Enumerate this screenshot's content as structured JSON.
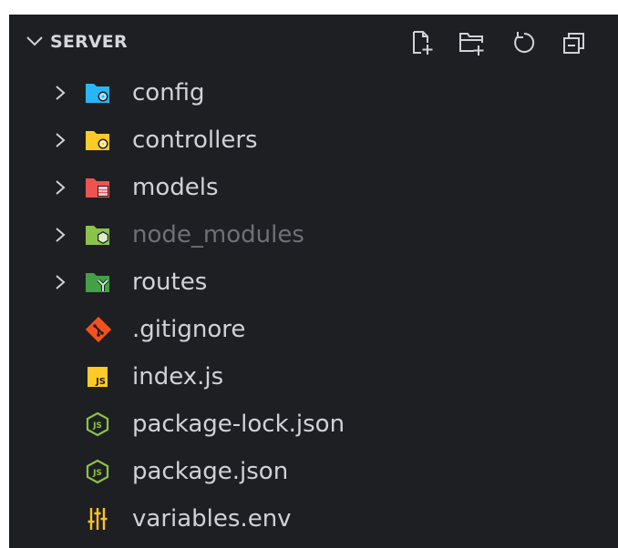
{
  "explorer": {
    "section_title": "SERVER",
    "toolbar": [
      {
        "icon": "new-file-icon"
      },
      {
        "icon": "new-folder-icon"
      },
      {
        "icon": "refresh-icon"
      },
      {
        "icon": "collapse-all-icon"
      }
    ],
    "items": [
      {
        "label": "config",
        "kind": "folder",
        "icon": "folder-config-icon",
        "color": "#29b6f6",
        "dimmed": false
      },
      {
        "label": "controllers",
        "kind": "folder",
        "icon": "folder-controllers-icon",
        "color": "#ffca28",
        "dimmed": false
      },
      {
        "label": "models",
        "kind": "folder",
        "icon": "folder-models-icon",
        "color": "#ef5350",
        "dimmed": false
      },
      {
        "label": "node_modules",
        "kind": "folder",
        "icon": "folder-node-icon",
        "color": "#8bc34a",
        "dimmed": true
      },
      {
        "label": "routes",
        "kind": "folder",
        "icon": "folder-routes-icon",
        "color": "#43a047",
        "dimmed": false
      },
      {
        "label": ".gitignore",
        "kind": "file",
        "icon": "git-icon",
        "color": "#f4511e",
        "dimmed": false
      },
      {
        "label": "index.js",
        "kind": "file",
        "icon": "javascript-icon",
        "color": "#ffca28",
        "dimmed": false
      },
      {
        "label": "package-lock.json",
        "kind": "file",
        "icon": "nodejs-icon",
        "color": "#8bc34a",
        "dimmed": false
      },
      {
        "label": "package.json",
        "kind": "file",
        "icon": "nodejs-icon",
        "color": "#8bc34a",
        "dimmed": false
      },
      {
        "label": "variables.env",
        "kind": "file",
        "icon": "settings-sliders-icon",
        "color": "#fbc02d",
        "dimmed": false
      }
    ]
  }
}
